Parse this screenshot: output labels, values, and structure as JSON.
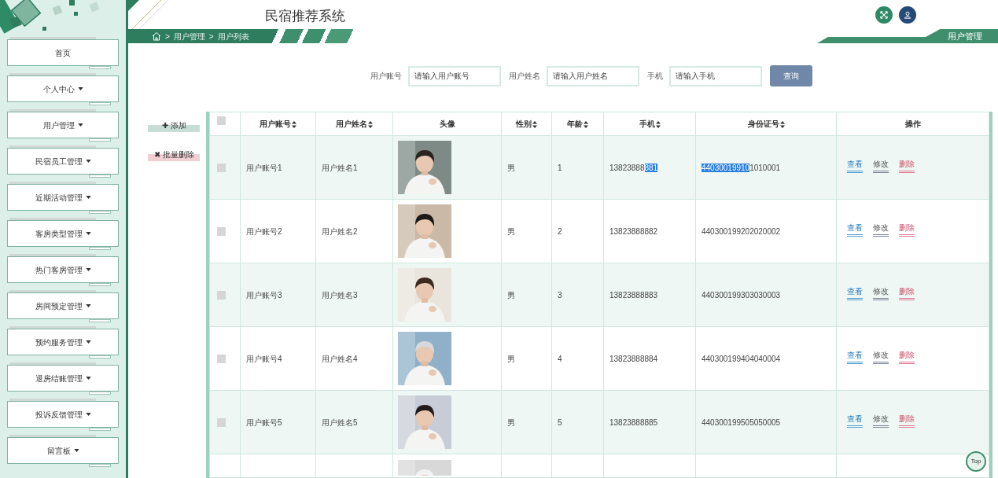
{
  "header": {
    "title": "民宿推荐系统",
    "breadcrumb": [
      ">",
      "用户管理",
      ">",
      "用户列表"
    ],
    "section_tab": "用户管理"
  },
  "sidebar": {
    "items": [
      {
        "label": "首页",
        "has_caret": false
      },
      {
        "label": "个人中心",
        "has_caret": true
      },
      {
        "label": "用户管理",
        "has_caret": true
      },
      {
        "label": "民宿员工管理",
        "has_caret": true
      },
      {
        "label": "近期活动管理",
        "has_caret": true
      },
      {
        "label": "客房类型管理",
        "has_caret": true
      },
      {
        "label": "热门客房管理",
        "has_caret": true
      },
      {
        "label": "房间预定管理",
        "has_caret": true
      },
      {
        "label": "预约服务管理",
        "has_caret": true
      },
      {
        "label": "退房结账管理",
        "has_caret": true
      },
      {
        "label": "投诉反馈管理",
        "has_caret": true
      },
      {
        "label": "留言板",
        "has_caret": true
      }
    ]
  },
  "search": {
    "fields": [
      {
        "label": "用户账号",
        "placeholder": "请输入用户账号"
      },
      {
        "label": "用户姓名",
        "placeholder": "请输入用户姓名"
      },
      {
        "label": "手机",
        "placeholder": "请输入手机"
      }
    ],
    "button": "查询"
  },
  "toolbar": [
    {
      "kind": "add",
      "icon": "✚",
      "label": "添加"
    },
    {
      "kind": "delete",
      "icon": "✖",
      "label": "批量删除"
    }
  ],
  "table": {
    "header_checked": false,
    "columns": [
      {
        "label": "用户账号",
        "sortable": true
      },
      {
        "label": "用户姓名",
        "sortable": true
      },
      {
        "label": "头像",
        "sortable": false
      },
      {
        "label": "性别",
        "sortable": true
      },
      {
        "label": "年龄",
        "sortable": true
      },
      {
        "label": "手机",
        "sortable": true
      },
      {
        "label": "身份证号",
        "sortable": true
      },
      {
        "label": "操作",
        "sortable": false
      }
    ],
    "rows": [
      {
        "checked": false,
        "account": "用户账号1",
        "name": "用户姓名1",
        "avatar": {
          "kind": "picture"
        },
        "gender": "男",
        "age": "1",
        "phone": [
          {
            "text": "13823888",
            "highlighted": false
          },
          {
            "text": "881",
            "highlighted": true
          }
        ],
        "id_number": [
          {
            "text": "44030019910",
            "highlighted": true
          },
          {
            "text": "1010001",
            "highlighted": false
          }
        ],
        "actions": [
          {
            "kind": "view",
            "label": "查看"
          },
          {
            "kind": "edit",
            "label": "修改"
          },
          {
            "kind": "delete",
            "label": "删除"
          }
        ]
      },
      {
        "checked": false,
        "account": "用户账号2",
        "name": "用户姓名2",
        "avatar": {
          "kind": "picture"
        },
        "gender": "男",
        "age": "2",
        "phone": [
          {
            "text": "13823888882",
            "highlighted": false
          }
        ],
        "id_number": [
          {
            "text": "440300199202020002",
            "highlighted": false
          }
        ],
        "actions": [
          {
            "kind": "view",
            "label": "查看"
          },
          {
            "kind": "edit",
            "label": "修改"
          },
          {
            "kind": "delete",
            "label": "删除"
          }
        ]
      },
      {
        "checked": false,
        "account": "用户账号3",
        "name": "用户姓名3",
        "avatar": {
          "kind": "picture"
        },
        "gender": "男",
        "age": "3",
        "phone": [
          {
            "text": "13823888883",
            "highlighted": false
          }
        ],
        "id_number": [
          {
            "text": "440300199303030003",
            "highlighted": false
          }
        ],
        "actions": [
          {
            "kind": "view",
            "label": "查看"
          },
          {
            "kind": "edit",
            "label": "修改"
          },
          {
            "kind": "delete",
            "label": "删除"
          }
        ]
      },
      {
        "checked": false,
        "account": "用户账号4",
        "name": "用户姓名4",
        "avatar": {
          "kind": "picture"
        },
        "gender": "男",
        "age": "4",
        "phone": [
          {
            "text": "13823888884",
            "highlighted": false
          }
        ],
        "id_number": [
          {
            "text": "440300199404040004",
            "highlighted": false
          }
        ],
        "actions": [
          {
            "kind": "view",
            "label": "查看"
          },
          {
            "kind": "edit",
            "label": "修改"
          },
          {
            "kind": "delete",
            "label": "删除"
          }
        ]
      },
      {
        "checked": false,
        "account": "用户账号5",
        "name": "用户姓名5",
        "avatar": {
          "kind": "picture"
        },
        "gender": "男",
        "age": "5",
        "phone": [
          {
            "text": "13823888885",
            "highlighted": false
          }
        ],
        "id_number": [
          {
            "text": "440300199505050005",
            "highlighted": false
          }
        ],
        "actions": [
          {
            "kind": "view",
            "label": "查看"
          },
          {
            "kind": "edit",
            "label": "修改"
          },
          {
            "kind": "delete",
            "label": "删除"
          }
        ]
      }
    ],
    "partial_row": {
      "avatar": {
        "kind": "picture"
      }
    }
  },
  "back_to_top": "Top"
}
